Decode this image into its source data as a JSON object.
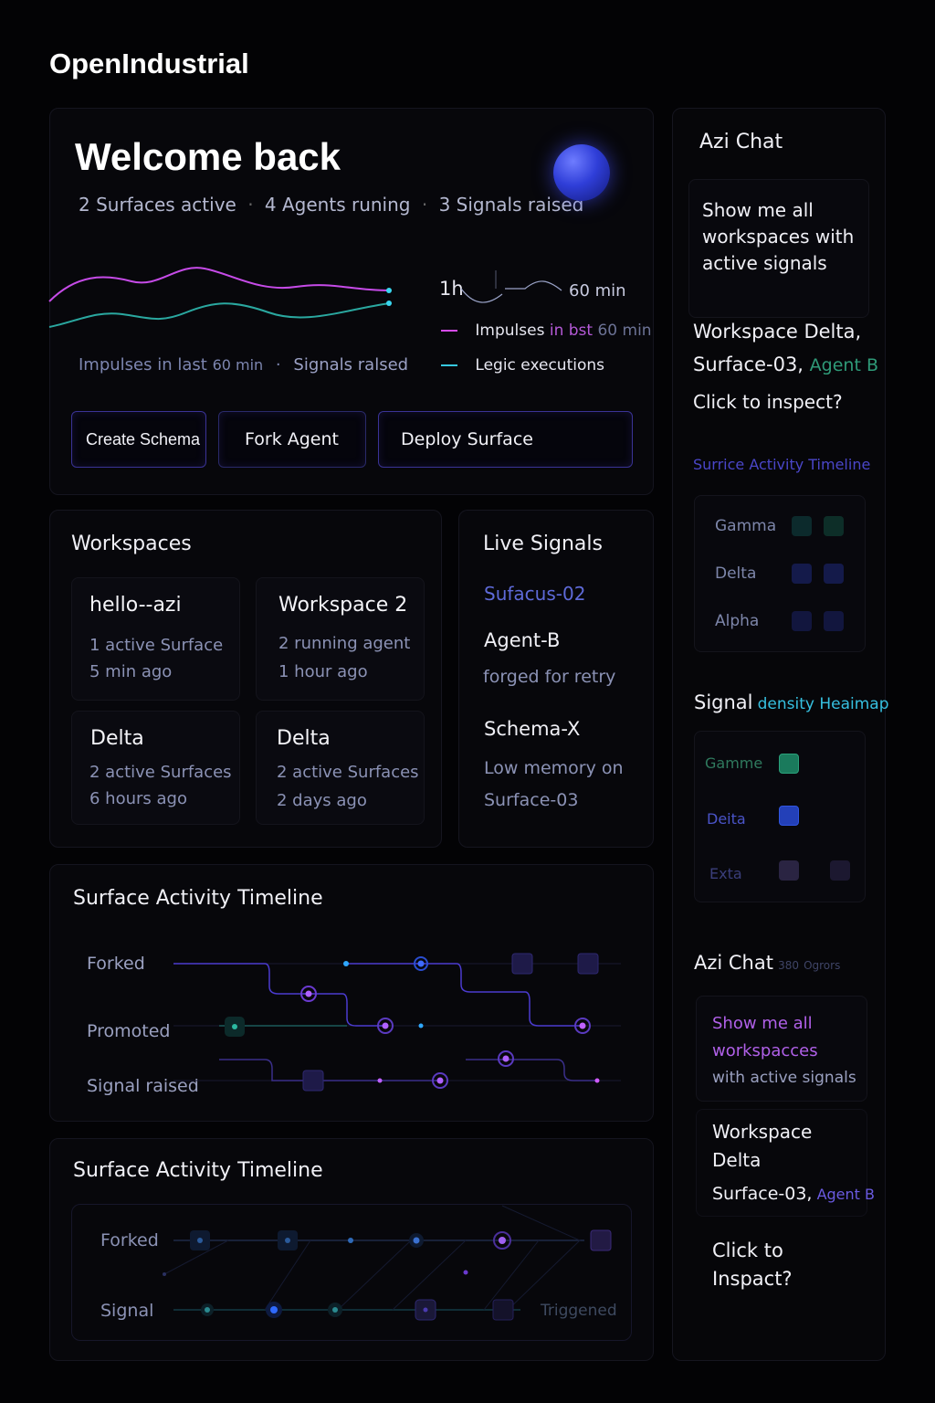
{
  "app": {
    "title": "OpenIndustrial"
  },
  "welcome": {
    "title": "Welcome back",
    "stats": [
      "2 Surfaces active",
      "4 Agents runing",
      "3 Signals raised"
    ],
    "sep": "·",
    "chart_caption_left": "Impulses in last",
    "chart_caption_left_num": "60 min",
    "chart_caption_sep": "·",
    "chart_caption_right": "Signals ralsed",
    "range_label": "1h",
    "range_value": "60 min",
    "legend": [
      {
        "label": "Impulses",
        "label_rest": "in bst",
        "label_num": "60 min",
        "color": "#d64bf0"
      },
      {
        "label": "Legic executions",
        "color": "#36c8e0"
      }
    ]
  },
  "actions": {
    "create_schema": "Create Schema",
    "fork_agent": "Fork Agent",
    "deploy_surface": "Deploy Surface"
  },
  "workspaces": {
    "title": "Workspaces",
    "items": [
      {
        "name": "hello--azi",
        "line1": "1 active Surface",
        "line2": "5 min ago"
      },
      {
        "name": "Workspace 2",
        "line1": "2 running agent",
        "line2": "1 hour ago"
      },
      {
        "name": "Delta",
        "line1": "2 active Surfaces",
        "line2": "6 hours ago"
      },
      {
        "name": "Delta",
        "line1": "2 active Surfaces",
        "line2": "2 days ago"
      }
    ]
  },
  "live_signals": {
    "title": "Live Signals",
    "items": [
      {
        "name": "Sufacus-02",
        "detail": ""
      },
      {
        "name": "Agent-B",
        "detail": "forged for retry"
      },
      {
        "name": "Schema-X",
        "detail": "Low memory on Surface-03"
      }
    ],
    "detail_line1": "Low memory on",
    "detail_line2": "Surface-03"
  },
  "timeline1": {
    "title": "Surface Activity Timeline",
    "rows": [
      "Forked",
      "Promoted",
      "Signal raised"
    ]
  },
  "timeline2": {
    "title": "Surface Activity Timeline",
    "rows": [
      "Forked",
      "Signal"
    ],
    "end_label": "Triggened"
  },
  "chat": {
    "title": "Azi Chat",
    "user_msg": "Show me all workspaces with active signals",
    "reply_line1": "Workspace Delta,",
    "reply_line2": "Surface-03,",
    "reply_agent": "Agent B",
    "reply_line3": "Click to inspect?",
    "timeline_link": "Surrice Activity Timeline",
    "activity_rows": [
      "Gamma",
      "Delta",
      "Alpha"
    ]
  },
  "heatmap": {
    "title_a": "Signal",
    "title_b": "density Heaimap",
    "rows": [
      {
        "label": "Gamme",
        "color": "#1a7a5c"
      },
      {
        "label": "Deita",
        "color": "#2340b8"
      },
      {
        "label": "Exta",
        "color": "#2a2442"
      }
    ]
  },
  "chat2": {
    "title": "Azi Chat",
    "badge": "380",
    "badge_text": "Ogrors",
    "user_line1": "Show me all",
    "user_line2": "workspacces",
    "user_line3": "with active signals",
    "reply_line1": "Workspace",
    "reply_line2": "Delta",
    "reply_line3": "Surface-03,",
    "reply_agent": "Agent B",
    "reply_line4": "Click to",
    "reply_line5": "Inspact?"
  }
}
